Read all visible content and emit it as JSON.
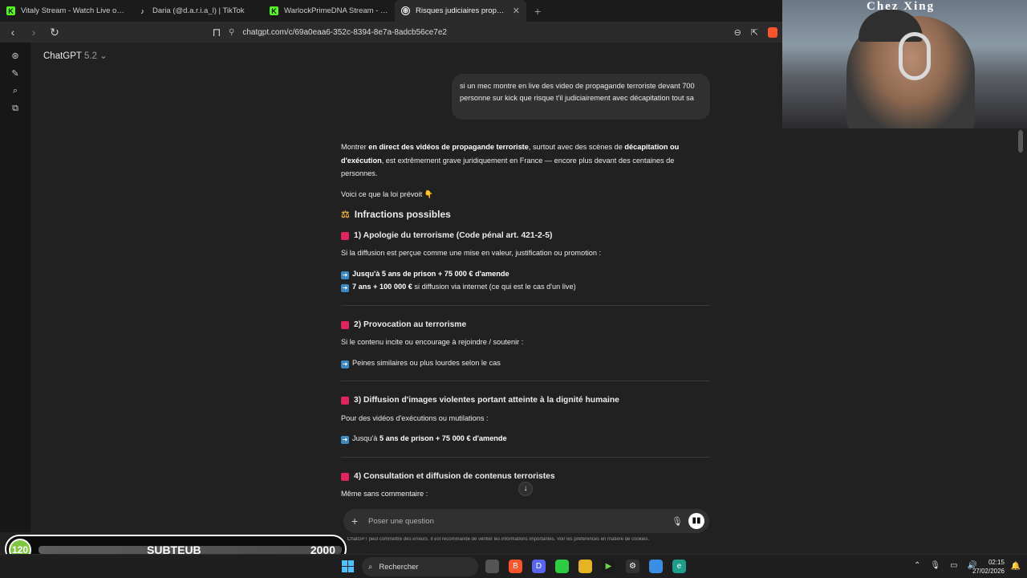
{
  "browser": {
    "tabs": [
      {
        "title": "Vitaly Stream - Watch Live on Kick",
        "icon": "kick-icon",
        "color": "#53fc18"
      },
      {
        "title": "Daria (@d.a.r.i.a_l) | TikTok",
        "icon": "tiktok-icon",
        "color": "#ffffff"
      },
      {
        "title": "WarlockPrimeDNA Stream - Watch L",
        "icon": "kick-icon",
        "color": "#53fc18"
      },
      {
        "title": "Risques judiciaires propagande",
        "icon": "chatgpt-icon",
        "color": "#ffffff"
      }
    ],
    "new_tab": "+",
    "url": "chatgpt.com/c/69a0eaa6-352c-8394-8e7a-8adcb56ce7e2"
  },
  "chatgpt": {
    "model_name": "ChatGPT",
    "model_version": "5.2",
    "user_message": "si un mec montre en live des video de propagande terroriste devant 700 personne sur kick que risque t'il judiciairement avec décapitation tout sa",
    "answer": {
      "intro_a": "Montrer ",
      "intro_b1": "en direct des vidéos de propagande terroriste",
      "intro_c": ", surtout avec des scènes de ",
      "intro_b2": "décapitation ou d'exécution",
      "intro_d": ", est extrêmement grave juridiquement en France — encore plus devant des centaines de personnes.",
      "lead": "Voici ce que la loi prévoit 👇",
      "section_title": "Infractions possibles",
      "s1_title": "1) Apologie du terrorisme (Code pénal art. 421-2-5)",
      "s1_text": "Si la diffusion est perçue comme une mise en valeur, justification ou promotion :",
      "s1_b1": "Jusqu'à 5 ans de prison + 75 000 € d'amende",
      "s1_b2_bold": "7 ans + 100 000 €",
      "s1_b2_rest": " si diffusion via internet (ce qui est le cas d'un live)",
      "s2_title": "2) Provocation au terrorisme",
      "s2_text": "Si le contenu incite ou encourage à rejoindre / soutenir :",
      "s2_b1": "Peines similaires ou plus lourdes selon le cas",
      "s3_title": "3) Diffusion d'images violentes portant atteinte à la dignité humaine",
      "s3_text": "Pour des vidéos d'exécutions ou mutilations :",
      "s3_b1_pre": "Jusqu'à ",
      "s3_b1_bold": "5 ans de prison + 75 000 € d'amende",
      "s4_title": "4) Consultation et diffusion de contenus terroristes",
      "s4_text": "Même sans commentaire :"
    },
    "composer_placeholder": "Poser une question",
    "disclaimer": "ChatGPT peut commettre des erreurs. Il est recommandé de vérifier les informations importantes. Voir les préférences en matière de cookies."
  },
  "webcam": {
    "sign": "Chez Xing"
  },
  "overlay": {
    "current": "120",
    "label": "SUBTEUB",
    "goal": "2000"
  },
  "taskbar": {
    "search_label": "Rechercher",
    "time": "02:15",
    "date": "27/02/2026"
  }
}
